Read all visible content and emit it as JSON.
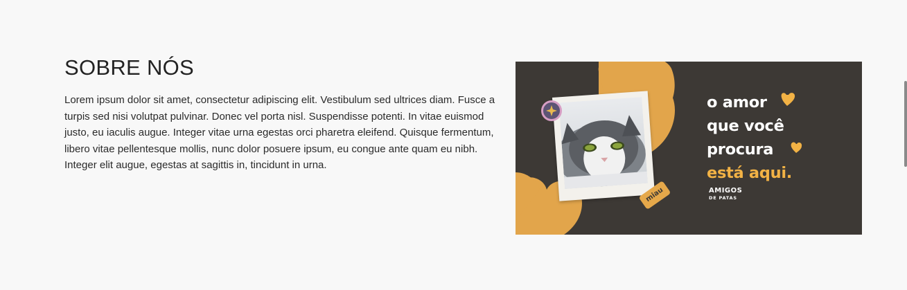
{
  "about": {
    "title": "SOBRE NÓS",
    "body": "Lorem ipsum dolor sit amet, consectetur adipiscing elit. Vestibulum sed ultrices diam. Fusce a turpis sed nisi volutpat pulvinar. Donec vel porta nisl. Suspendisse potenti. In vitae euismod justo, eu iaculis augue. Integer vitae urna egestas orci pharetra eleifend. Quisque fermentum, libero vitae pellentesque mollis, nunc dolor posuere ipsum, eu congue ante quam eu nibh. Integer elit augue, egestas at sagittis in, tincidunt in urna."
  },
  "banner": {
    "tagline": [
      "o amor",
      "que você",
      "procura",
      "está aqui."
    ],
    "sticker": "miau",
    "logo_main": "AMIGOS",
    "logo_sub": "DE PATAS",
    "colors": {
      "background": "#3d3935",
      "accent": "#f2b245",
      "heart": "#e2a54b",
      "text": "#ffffff"
    },
    "icons": [
      "heart-icon",
      "star-icon",
      "cat-photo"
    ]
  }
}
